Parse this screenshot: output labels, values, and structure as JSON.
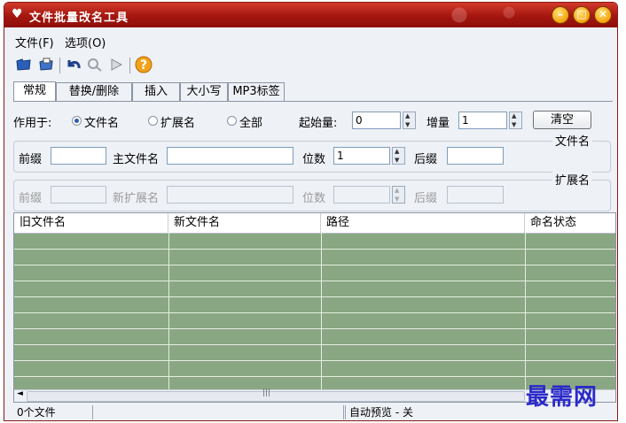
{
  "window": {
    "title": "文件批量改名工具"
  },
  "menu": [
    "文件(F)",
    "选项(O)"
  ],
  "toolbar_icons": [
    "open-folder-icon",
    "open-file-icon",
    "undo-icon",
    "search-icon",
    "play-icon",
    "help-icon"
  ],
  "tabs": [
    "常规",
    "替换/删除",
    "插入",
    "大小写",
    "MP3标签"
  ],
  "general": {
    "apply_to_label": "作用于:",
    "options": [
      "文件名",
      "扩展名",
      "全部"
    ],
    "selected": "文件名",
    "start_label": "起始量:",
    "start_value": "0",
    "increment_label": "增量",
    "increment_value": "1",
    "clear_button": "清空"
  },
  "filename_group": {
    "title": "文件名",
    "prefix_label": "前缀",
    "prefix_value": "",
    "main_label": "主文件名",
    "main_value": "",
    "digits_label": "位数",
    "digits_value": "1",
    "suffix_label": "后缀",
    "suffix_value": ""
  },
  "extension_group": {
    "title": "扩展名",
    "prefix_label": "前缀",
    "new_ext_label": "新扩展名",
    "digits_label": "位数",
    "suffix_label": "后缀"
  },
  "table": {
    "columns": [
      "旧文件名",
      "新文件名",
      "路径",
      "命名状态"
    ],
    "rows": []
  },
  "status": {
    "file_count": "0个文件",
    "preview": "自动预览 - 关"
  },
  "watermark": "最需网"
}
